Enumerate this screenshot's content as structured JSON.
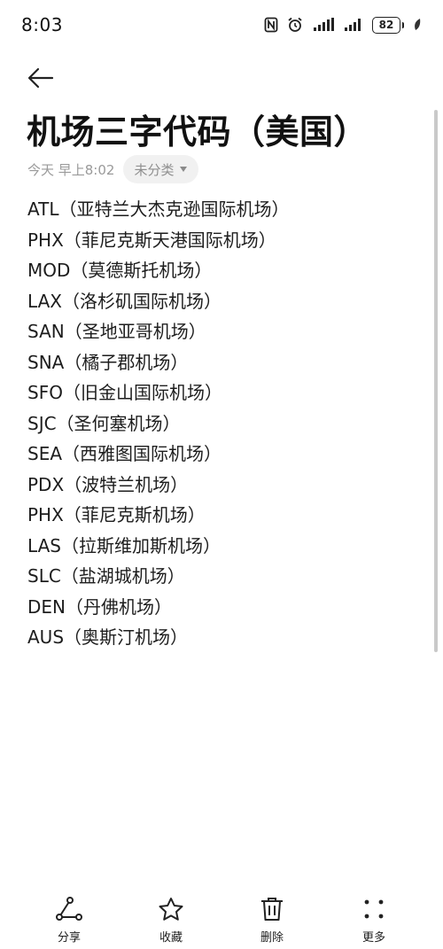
{
  "status_bar": {
    "time": "8:03",
    "battery": "82"
  },
  "note": {
    "title": "机场三字代码（美国）",
    "date": "今天 早上8:02",
    "category": "未分类",
    "lines": [
      "ATL（亚特兰大杰克逊国际机场）",
      "PHX（菲尼克斯天港国际机场）",
      "MOD（莫德斯托机场）",
      "LAX（洛杉矶国际机场）",
      "SAN（圣地亚哥机场）",
      "SNA（橘子郡机场）",
      "SFO（旧金山国际机场）",
      "SJC（圣何塞机场）",
      "SEA（西雅图国际机场）",
      "PDX（波特兰机场）",
      "PHX（菲尼克斯机场）",
      "LAS（拉斯维加斯机场）",
      "SLC（盐湖城机场）",
      "DEN（丹佛机场）",
      "AUS（奥斯汀机场）"
    ]
  },
  "toolbar": {
    "share_label": "分享",
    "favorite_label": "收藏",
    "delete_label": "删除",
    "more_label": "更多"
  },
  "icons": {
    "back": "arrow-left-icon",
    "share": "share-icon",
    "favorite": "star-icon",
    "delete": "trash-icon",
    "more": "more-dots-icon",
    "dropdown": "caret-down-icon"
  }
}
